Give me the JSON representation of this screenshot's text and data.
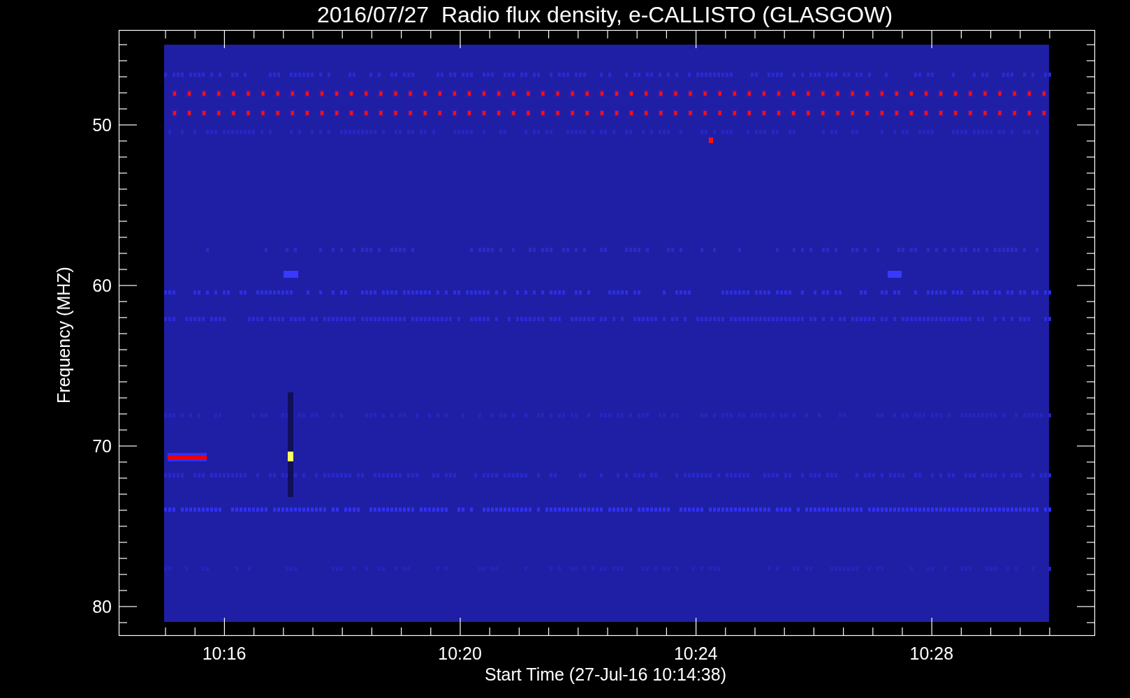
{
  "title": "2016/07/27  Radio flux density, e-CALLISTO (GLASGOW)",
  "y_axis": {
    "label": "Frequency (MHZ)",
    "ticks": [
      "50",
      "60",
      "70",
      "80"
    ]
  },
  "x_axis": {
    "label": "Start Time (27-Jul-16 10:14:38)",
    "ticks": [
      "10:16",
      "10:20",
      "10:24",
      "10:28"
    ]
  }
}
